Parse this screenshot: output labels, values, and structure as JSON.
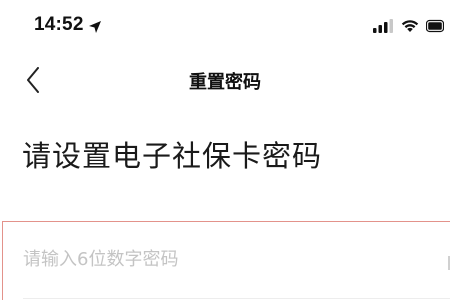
{
  "status_bar": {
    "time": "14:52",
    "icons": [
      "location-arrow-icon",
      "cellular-signal-icon",
      "wifi-icon",
      "battery-icon"
    ]
  },
  "nav": {
    "back_icon": "chevron-left-icon",
    "title": "重置密码"
  },
  "main": {
    "heading": "请设置电子社保卡密码",
    "password_input": {
      "placeholder": "请输入6位数字密码",
      "value": ""
    }
  },
  "colors": {
    "background": "#ffffff",
    "text": "#111111",
    "placeholder": "#c4c4c4",
    "input_border": "#e3928b"
  }
}
